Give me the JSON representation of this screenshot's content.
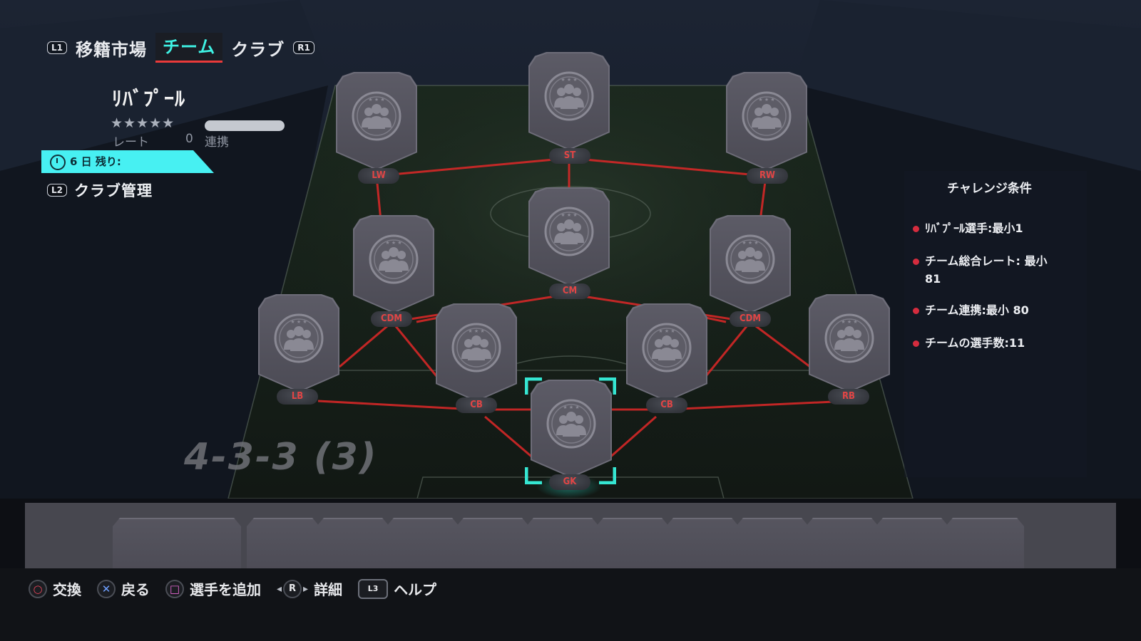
{
  "tabs": {
    "left_bumper": "L1",
    "right_bumper": "R1",
    "items": [
      "移籍市場",
      "チーム",
      "クラブ"
    ],
    "active_index": 1
  },
  "club": {
    "name": "ﾘﾊﾞﾌﾟｰﾙ",
    "stars": "★★★★★",
    "rating_label": "レート",
    "rating_value": "0",
    "chem_label": "連携",
    "timer_text": "6 日 残り:",
    "manage_button": "L2",
    "manage_label": "クラブ管理"
  },
  "pitch": {
    "formation": "4-3-3 (3)",
    "positions": {
      "st": "ST",
      "lw": "LW",
      "rw": "RW",
      "cm": "CM",
      "cdm_l": "CDM",
      "cdm_r": "CDM",
      "lb": "LB",
      "cb_l": "CB",
      "cb_r": "CB",
      "rb": "RB",
      "gk": "GK"
    }
  },
  "challenge": {
    "title": "チャレンジ条件",
    "requirements": [
      "ﾘﾊﾞﾌﾟｰﾙ選手:最小1",
      "チーム総合レート: 最小",
      "81",
      "チーム連携:最小 80",
      "チームの選手数:11"
    ]
  },
  "footer": {
    "hints": [
      {
        "button": "○",
        "label": "交換"
      },
      {
        "button": "✕",
        "label": "戻る"
      },
      {
        "button": "□",
        "label": "選手を追加"
      },
      {
        "button": "R",
        "label": "詳細"
      },
      {
        "button": "L3",
        "label": "ヘルプ"
      }
    ]
  },
  "colors": {
    "accent_cyan": "#3ff2e4",
    "tab_underline": "#ea3a3a",
    "chem_line": "#e02828",
    "position_text": "#e24545",
    "requirement_dot": "#d52c3e"
  }
}
